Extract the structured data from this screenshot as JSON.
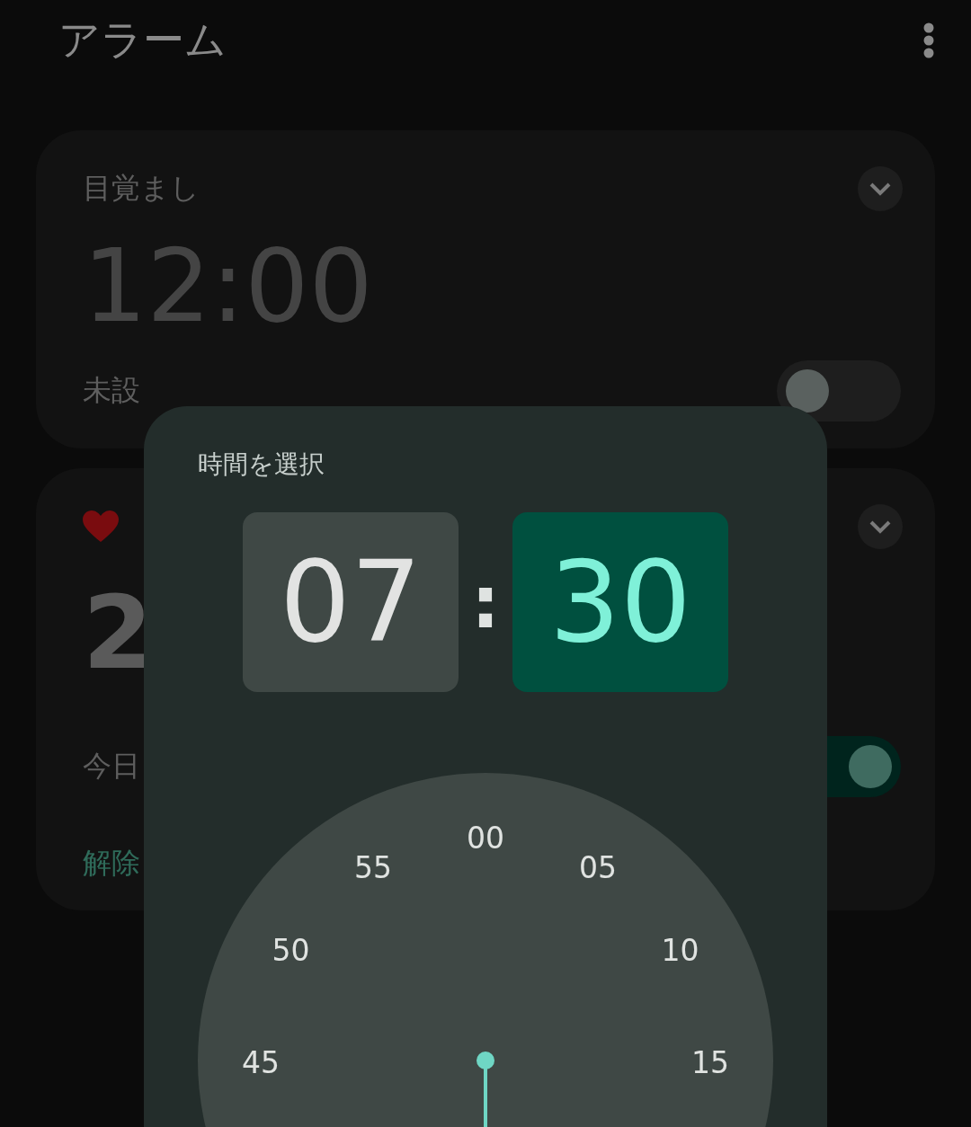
{
  "header": {
    "title": "アラーム"
  },
  "alarms": [
    {
      "kind": "named",
      "label": "目覚まし",
      "time": "12:00",
      "schedule": "未設",
      "on": false
    },
    {
      "kind": "favorite",
      "time": "2",
      "schedule": "今日",
      "on": true,
      "action": "解除"
    }
  ],
  "dialog": {
    "title": "時間を選択",
    "fields": [
      {
        "value": "07",
        "selected": false
      },
      {
        "value": "30",
        "selected": true
      }
    ],
    "separator": ":",
    "dial": [
      "00",
      "55",
      "05",
      "50",
      "10",
      "45",
      "15"
    ]
  }
}
